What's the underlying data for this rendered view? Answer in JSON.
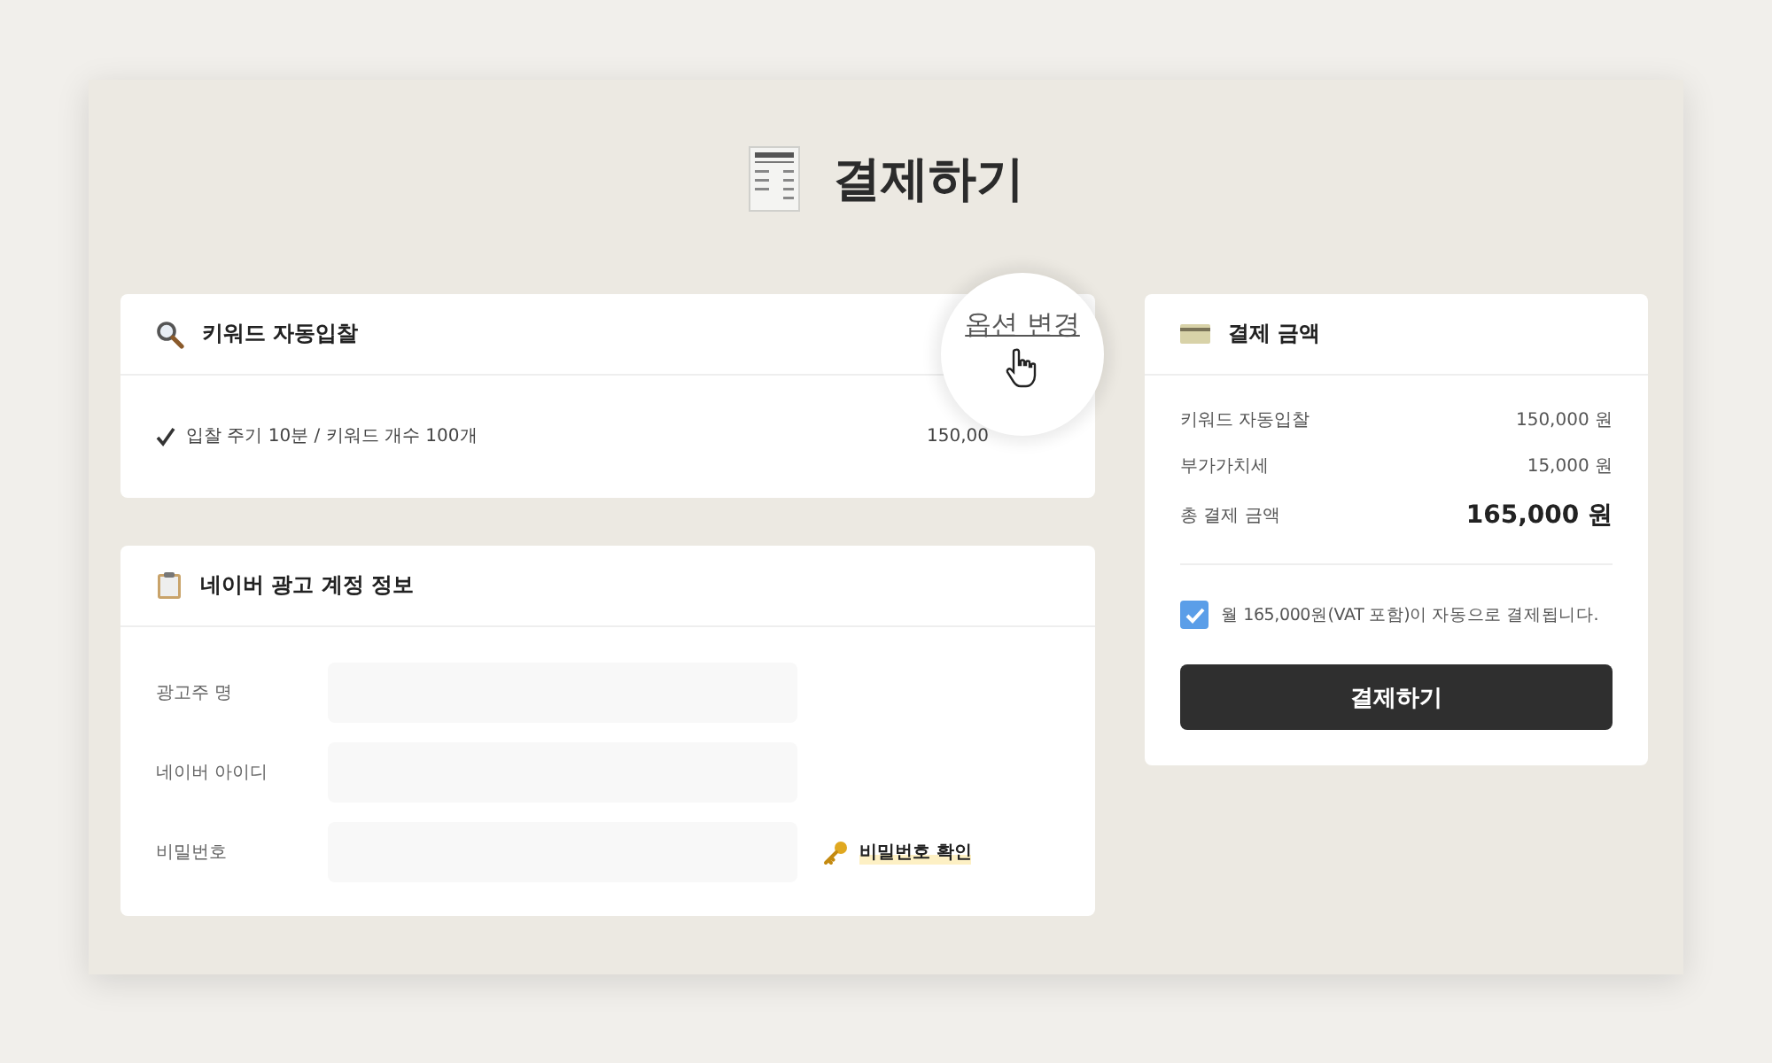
{
  "title": "결제하기",
  "keyword_card": {
    "title": "키워드 자동입찰",
    "action": "옵션 변경",
    "items": [
      {
        "label": "입찰 주기 10분 / 키워드 개수 100개",
        "price": "150,00",
        "checked": true
      }
    ]
  },
  "account_card": {
    "title": "네이버 광고 계정 정보",
    "fields": [
      {
        "label": "광고주 명"
      },
      {
        "label": "네이버 아이디"
      },
      {
        "label": "비밀번호",
        "action": "비밀번호 확인"
      }
    ]
  },
  "payment_card": {
    "title": "결제 금액",
    "rows": [
      {
        "label": "키워드 자동입찰",
        "amount": "150,000 원",
        "kind": "line"
      },
      {
        "label": "부가가치세",
        "amount": "15,000 원",
        "kind": "line"
      },
      {
        "label": "총 결제 금액",
        "amount": "165,000 원",
        "kind": "total"
      }
    ],
    "consent": {
      "label": "월 165,000원(VAT 포함)이 자동으로 결제됩니다.",
      "checked": true
    },
    "button": "결제하기"
  }
}
